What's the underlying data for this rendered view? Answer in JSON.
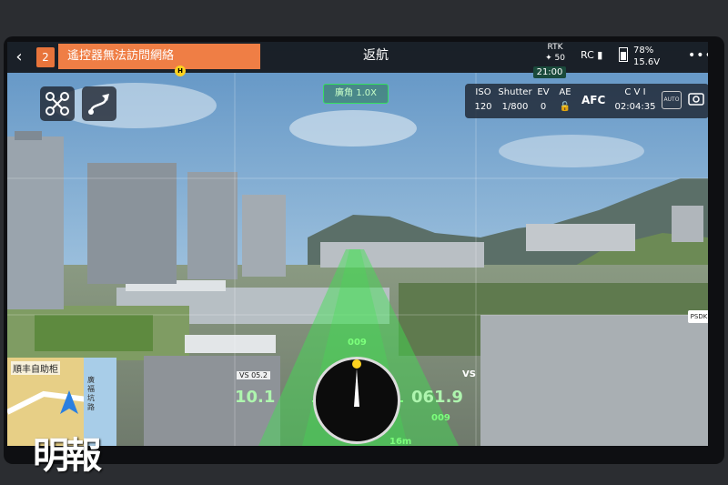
{
  "topbar": {
    "alert_count": "2",
    "alert_message": "遙控器無法訪問網絡",
    "rth_label": "返航",
    "rtk_label": "RTK",
    "rtk_count": "50",
    "rc_label": "RC",
    "battery_percent": "78%",
    "battery_voltage": "15.6V",
    "clock": "21:00",
    "home_marker": "H",
    "battery_level": 0.78
  },
  "zoom_label": "廣角 1.0X",
  "camera": {
    "iso_label": "ISO",
    "iso_value": "120",
    "shutter_label": "Shutter",
    "shutter_value": "1/800",
    "ev_label": "EV",
    "ev_value": "0",
    "ae_label": "AE",
    "focus_mode": "AFC",
    "storage_label": "C V I",
    "record_time": "02:04:35",
    "auto_label": "AUTO"
  },
  "map": {
    "place_label": "順丰自助柜",
    "road_label": "廣福坑路"
  },
  "hud": {
    "heading_top": "009",
    "speed_left": "10.1",
    "speed_right": "061.9",
    "vs_label": "VS 05.2",
    "alt_label": "009",
    "distance_label": "16m",
    "vs_right": "VS"
  },
  "psdk_label": "PSDK",
  "watermark": "明報",
  "colors": {
    "alert_orange": "#ef7e45",
    "hud_green": "#35e060",
    "topbar_bg": "#14161a"
  }
}
